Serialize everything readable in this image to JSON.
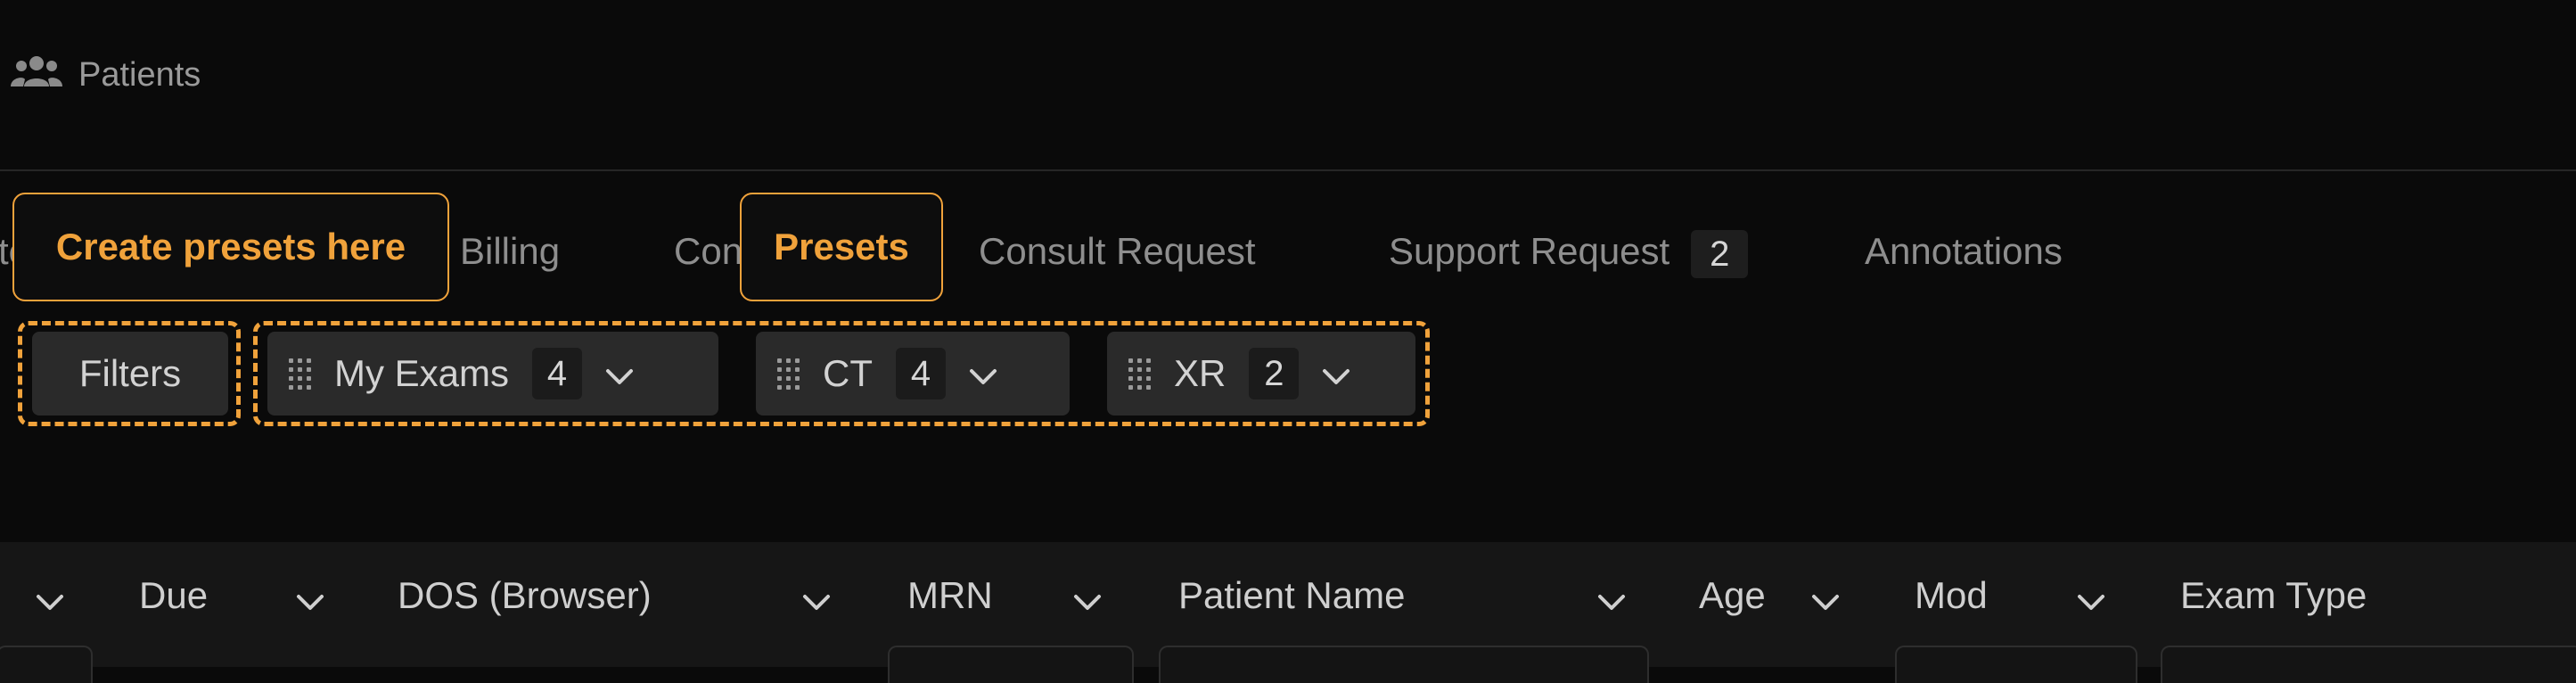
{
  "nav": {
    "patients_icon": "users-icon",
    "patients_label": "Patients"
  },
  "tabs": {
    "partial_left": "te",
    "billing": "Billing",
    "partial_con": "Con",
    "consult_request": "Consult Request",
    "support_request": "Support Request",
    "support_request_count": "2",
    "annotations": "Annotations"
  },
  "callouts": {
    "create_presets": "Create presets here",
    "presets": "Presets"
  },
  "filters": {
    "label": "Filters"
  },
  "presets": [
    {
      "label": "My Exams",
      "count": "4"
    },
    {
      "label": "CT",
      "count": "4"
    },
    {
      "label": "XR",
      "count": "2"
    }
  ],
  "table": {
    "columns": [
      "Due",
      "DOS (Browser)",
      "MRN",
      "Patient Name",
      "Age",
      "Mod",
      "Exam Type"
    ]
  },
  "colors": {
    "accent": "#f0a23b",
    "background": "#0a0a0a"
  }
}
